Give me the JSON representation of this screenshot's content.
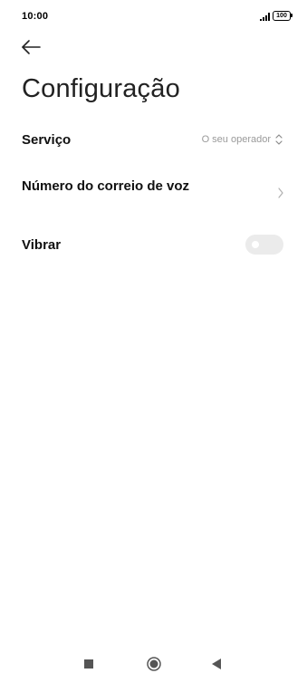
{
  "status_bar": {
    "time": "10:00",
    "battery_level": "100",
    "signal_icon": "signal-bars-icon",
    "battery_icon": "battery-icon"
  },
  "header": {
    "back_icon": "arrow-left-icon",
    "title": "Configuração"
  },
  "settings": {
    "service": {
      "label": "Serviço",
      "value": "O seu operador",
      "icon": "chevron-up-down-icon"
    },
    "voicemail": {
      "label": "Número do correio de voz",
      "icon": "chevron-right-icon"
    },
    "vibrate": {
      "label": "Vibrar",
      "enabled": false
    }
  },
  "nav_bar": {
    "recents_icon": "square-icon",
    "home_icon": "circle-icon",
    "back_icon": "triangle-back-icon"
  },
  "colors": {
    "background": "#ffffff",
    "secondary_text": "#9a9a9a",
    "toggle_off_track": "#ebebeb"
  }
}
